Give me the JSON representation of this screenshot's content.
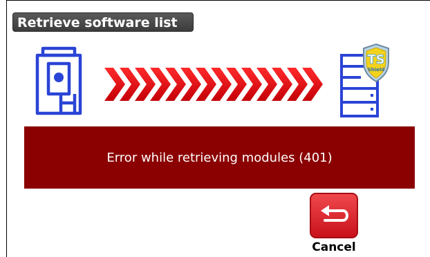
{
  "dialog": {
    "title": "Retrieve software list",
    "error_message": "Error while retrieving modules (401)"
  },
  "graphic": {
    "device_icon": "survey-instrument-icon",
    "transfer_icon": "transfer-arrows-icon",
    "server_icon": "server-icon",
    "badge": {
      "icon": "ts-shield-badge-icon",
      "text_main": "TS",
      "text_sub": "Shield"
    }
  },
  "actions": {
    "cancel": {
      "label": "Cancel",
      "icon": "return-arrow-icon"
    }
  },
  "colors": {
    "title_bg": "#4a4a4a",
    "error_bg": "#8b0000",
    "arrow_red": "#e8101a",
    "icon_blue": "#2a44d6",
    "cancel_red": "#d8141c"
  }
}
